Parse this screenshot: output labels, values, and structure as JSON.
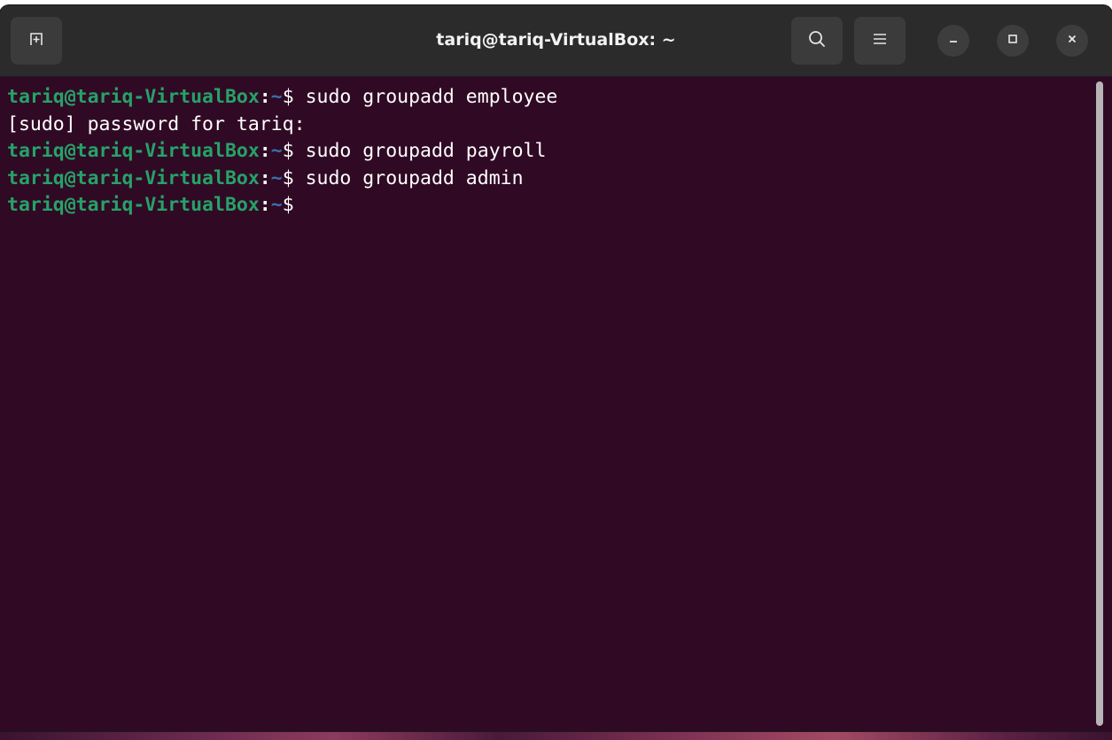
{
  "window": {
    "title": "tariq@tariq-VirtualBox: ~"
  },
  "icons": {
    "new_tab": "new-tab-icon",
    "search": "search-icon",
    "menu": "hamburger-menu-icon",
    "minimize": "minimize-icon",
    "maximize": "maximize-icon",
    "close": "close-icon"
  },
  "terminal": {
    "lines": [
      {
        "type": "prompt",
        "user": "tariq@tariq-VirtualBox",
        "colon": ":",
        "path": "~",
        "dollar": "$",
        "command": " sudo groupadd employee"
      },
      {
        "type": "output",
        "text": "[sudo] password for tariq:"
      },
      {
        "type": "prompt",
        "user": "tariq@tariq-VirtualBox",
        "colon": ":",
        "path": "~",
        "dollar": "$",
        "command": " sudo groupadd payroll"
      },
      {
        "type": "prompt",
        "user": "tariq@tariq-VirtualBox",
        "colon": ":",
        "path": "~",
        "dollar": "$",
        "command": " sudo groupadd admin"
      },
      {
        "type": "prompt",
        "user": "tariq@tariq-VirtualBox",
        "colon": ":",
        "path": "~",
        "dollar": "$",
        "command": ""
      }
    ]
  },
  "colors": {
    "background": "#300a24",
    "prompt_user": "#26a269",
    "prompt_path": "#3a6fb0",
    "titlebar": "#2b2b2b"
  }
}
